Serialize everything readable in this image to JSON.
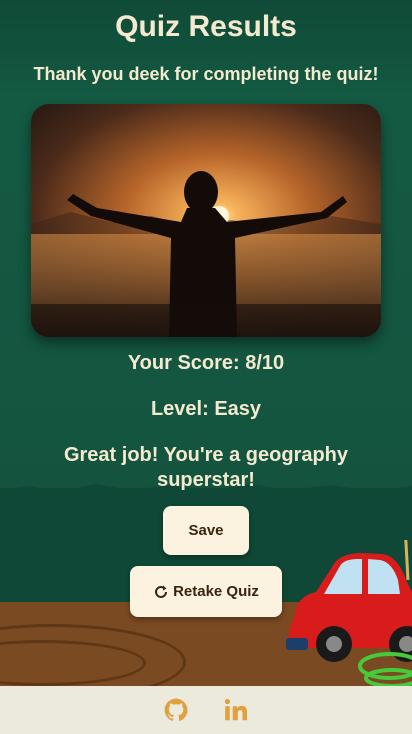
{
  "page": {
    "title": "Quiz Results",
    "thank_you": "Thank you deek for completing the quiz!",
    "score": "Your Score: 8/10",
    "level": "Level: Easy",
    "message": "Great job! You're a geography superstar!"
  },
  "buttons": {
    "save_label": "Save",
    "retake_label": "Retake Quiz",
    "retake_icon": "refresh-icon"
  },
  "footer": {
    "icons": [
      "github-icon",
      "linkedin-icon"
    ],
    "accent": "#e0a040"
  },
  "colors": {
    "background": "#14543f",
    "text": "#f4ead0",
    "button_bg": "#fbf3df",
    "footer_bg": "#ece9dd",
    "ground": "#7a4a22",
    "car": "#d81c1c"
  }
}
